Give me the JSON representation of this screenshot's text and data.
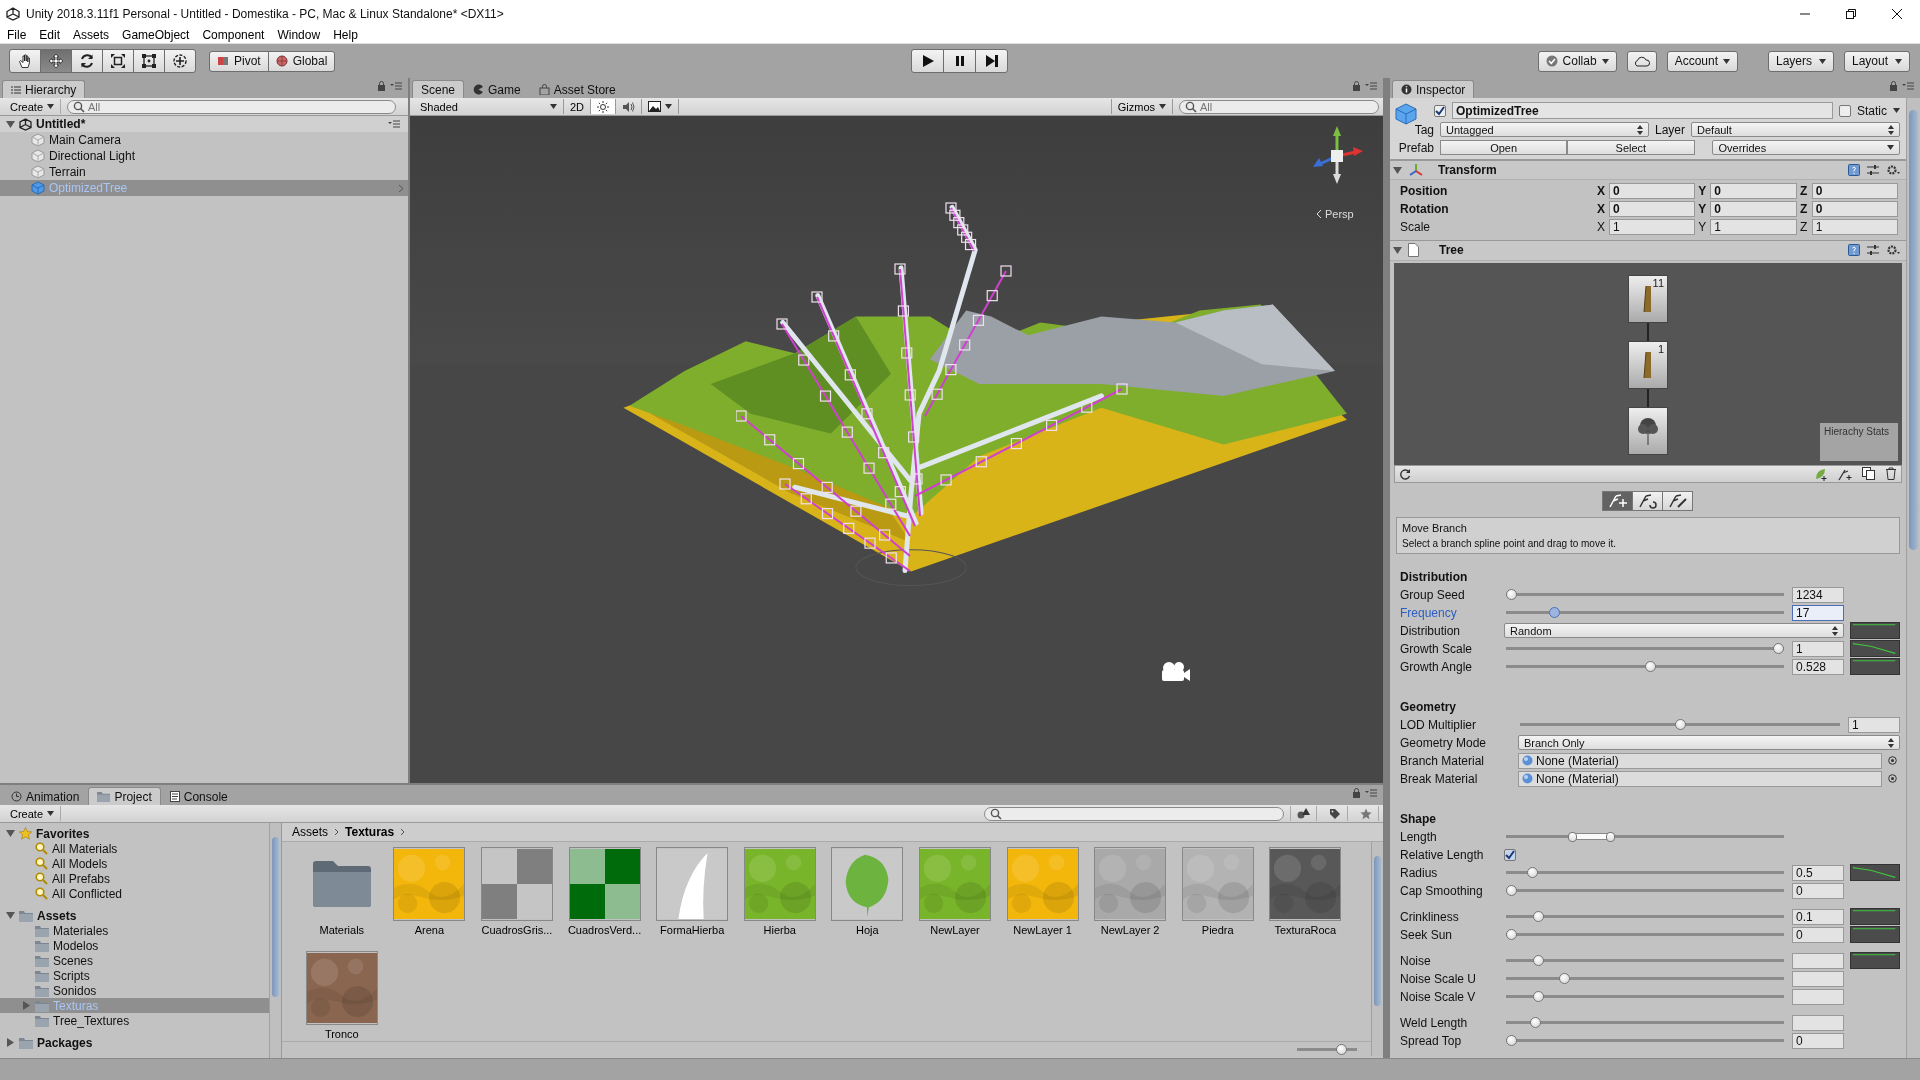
{
  "window": {
    "title": "Unity 2018.3.11f1 Personal - Untitled - Domestika - PC, Mac & Linux Standalone* <DX11>"
  },
  "menu": [
    "File",
    "Edit",
    "Assets",
    "GameObject",
    "Component",
    "Window",
    "Help"
  ],
  "toolbar": {
    "tools": [
      {
        "kind": "hand",
        "selected": false
      },
      {
        "kind": "move",
        "selected": true
      },
      {
        "kind": "rotate",
        "selected": false
      },
      {
        "kind": "scale",
        "selected": false
      },
      {
        "kind": "rect",
        "selected": false
      },
      {
        "kind": "transform",
        "selected": false
      }
    ],
    "pivot": "Pivot",
    "space": "Global",
    "play": [
      {
        "kind": "play",
        "selected": false
      },
      {
        "kind": "pause",
        "selected": false
      },
      {
        "kind": "step",
        "selected": false
      }
    ],
    "collab": "Collab",
    "account": "Account",
    "layers": "Layers",
    "layout": "Layout"
  },
  "hierarchy": {
    "tab": "Hierarchy",
    "create": "Create",
    "search_placeholder": "All",
    "scene": "Untitled*",
    "items": [
      {
        "label": "Main Camera",
        "kind": "object",
        "selected": false
      },
      {
        "label": "Directional Light",
        "kind": "object",
        "selected": false
      },
      {
        "label": "Terrain",
        "kind": "object",
        "selected": false
      },
      {
        "label": "OptimizedTree",
        "kind": "prefab",
        "selected": true
      }
    ]
  },
  "scene": {
    "tabs": [
      {
        "label": "Scene",
        "kind": "scene",
        "selected": true
      },
      {
        "label": "Game",
        "kind": "game",
        "selected": false
      },
      {
        "label": "Asset Store",
        "kind": "store",
        "selected": false
      }
    ],
    "shading": "Shaded",
    "mode_2d": "2D",
    "lighting": true,
    "audio": false,
    "gizmos": "Gizmos",
    "search_placeholder": "All",
    "projection": "Persp"
  },
  "inspector": {
    "tab": "Inspector",
    "active": true,
    "name": "OptimizedTree",
    "static": false,
    "static_label": "Static",
    "tag_label": "Tag",
    "tag": "Untagged",
    "layer_label": "Layer",
    "layer": "Default",
    "prefab_label": "Prefab",
    "prefab_buttons": [
      "Open",
      "Select"
    ],
    "overrides": "Overrides",
    "transform": {
      "title": "Transform",
      "rows": [
        {
          "label": "Position",
          "overridden": true,
          "fields": [
            {
              "axis": "X",
              "value": "0"
            },
            {
              "axis": "Y",
              "value": "0"
            },
            {
              "axis": "Z",
              "value": "0"
            }
          ]
        },
        {
          "label": "Rotation",
          "overridden": true,
          "fields": [
            {
              "axis": "X",
              "value": "0"
            },
            {
              "axis": "Y",
              "value": "0"
            },
            {
              "axis": "Z",
              "value": "0"
            }
          ]
        },
        {
          "label": "Scale",
          "overridden": false,
          "fields": [
            {
              "axis": "X",
              "value": "1"
            },
            {
              "axis": "Y",
              "value": "1"
            },
            {
              "axis": "Z",
              "value": "1"
            }
          ]
        }
      ]
    },
    "tree": {
      "title": "Tree",
      "nodes": [
        {
          "kind": "branch",
          "count": "11"
        },
        {
          "kind": "branch",
          "count": "1"
        },
        {
          "kind": "leaf"
        }
      ],
      "stats": "Hierachy Stats",
      "modes": [
        {
          "kind": "move",
          "selected": true
        },
        {
          "kind": "rotate",
          "selected": false
        },
        {
          "kind": "draw",
          "selected": false
        }
      ],
      "help_title": "Move Branch",
      "help_text": "Select a branch spline point and drag to move it.",
      "sections": [
        {
          "title": "Distribution",
          "groups": [
            [
              {
                "kind": "slider",
                "label": "Group Seed",
                "level": 0,
                "value": "1234",
                "focused": false
              },
              {
                "kind": "slider",
                "label": "Frequency",
                "level": 0.16,
                "value": "17",
                "focused": true
              },
              {
                "kind": "dropdown",
                "label": "Distribution",
                "value": "Random",
                "curve": {
                  "kind": "flat"
                }
              },
              {
                "kind": "slider",
                "label": "Growth Scale",
                "level": 1,
                "value": "1",
                "focused": false,
                "curve": {
                  "kind": "falling"
                }
              },
              {
                "kind": "slider",
                "label": "Growth Angle",
                "level": 0.52,
                "value": "0.528",
                "focused": false,
                "curve": {
                  "kind": "flat"
                }
              }
            ]
          ]
        },
        {
          "title": "Geometry",
          "groups": [
            [
              {
                "kind": "slider",
                "label": "LOD Multiplier",
                "level": 0.5,
                "value": "1",
                "focused": false
              },
              {
                "kind": "dropdown",
                "label": "Geometry Mode",
                "value": "Branch Only"
              },
              {
                "kind": "object",
                "label": "Branch Material",
                "value": "None (Material)"
              },
              {
                "kind": "object",
                "label": "Break Material",
                "value": "None (Material)"
              }
            ]
          ]
        },
        {
          "title": "Shape",
          "groups": [
            [
              {
                "kind": "range",
                "label": "Length",
                "handles": [
                  {
                    "level": 0.23
                  },
                  {
                    "level": 0.37
                  }
                ]
              },
              {
                "kind": "checkbox",
                "label": "Relative Length",
                "checked": true
              },
              {
                "kind": "slider",
                "label": "Radius",
                "level": 0.08,
                "value": "0.5",
                "focused": false,
                "curve": {
                  "kind": "falling"
                }
              },
              {
                "kind": "slider",
                "label": "Cap Smoothing",
                "level": 0,
                "value": "0",
                "focused": false
              }
            ],
            [
              {
                "kind": "slider",
                "label": "Crinkliness",
                "level": 0.1,
                "value": "0.1",
                "focused": false,
                "curve": {
                  "kind": "flat"
                }
              },
              {
                "kind": "slider",
                "label": "Seek Sun",
                "level": 0,
                "value": "0",
                "focused": false,
                "curve": {
                  "kind": "flat"
                }
              }
            ],
            [
              {
                "kind": "slider",
                "label": "Noise",
                "level": 0.1,
                "focused": false,
                "curve": {
                  "kind": "flat"
                }
              },
              {
                "kind": "slider",
                "label": "Noise Scale U",
                "level": 0.2,
                "focused": false
              },
              {
                "kind": "slider",
                "label": "Noise Scale V",
                "level": 0.1,
                "focused": false
              }
            ],
            [
              {
                "kind": "slider",
                "label": "Weld Length",
                "level": 0.09,
                "focused": false
              },
              {
                "kind": "slider",
                "label": "Spread Top",
                "level": 0,
                "value": "0",
                "focused": false
              }
            ]
          ]
        }
      ]
    }
  },
  "project": {
    "tabs": [
      {
        "label": "Animation",
        "kind": "clock",
        "selected": false
      },
      {
        "label": "Project",
        "kind": "folder",
        "selected": true
      },
      {
        "label": "Console",
        "kind": "console",
        "selected": false
      }
    ],
    "create": "Create",
    "tree": [
      {
        "label": "Favorites",
        "kind": "star",
        "expanded": true,
        "selected": false,
        "children": [
          {
            "label": "All Materials",
            "kind": "search",
            "selected": false
          },
          {
            "label": "All Models",
            "kind": "search",
            "selected": false
          },
          {
            "label": "All Prefabs",
            "kind": "search",
            "selected": false
          },
          {
            "label": "All Conflicted",
            "kind": "search",
            "selected": false
          }
        ]
      },
      {
        "label": "Assets",
        "kind": "folder",
        "expanded": true,
        "selected": false,
        "children": [
          {
            "label": "Materiales",
            "kind": "folder",
            "selected": false
          },
          {
            "label": "Modelos",
            "kind": "folder",
            "selected": false
          },
          {
            "label": "Scenes",
            "kind": "folder",
            "selected": false
          },
          {
            "label": "Scripts",
            "kind": "folder",
            "selected": false
          },
          {
            "label": "Sonidos",
            "kind": "folder",
            "selected": false
          },
          {
            "label": "Texturas",
            "kind": "folder",
            "expanded": false,
            "selected": true
          },
          {
            "label": "Tree_Textures",
            "kind": "folder",
            "selected": false
          }
        ]
      },
      {
        "label": "Packages",
        "kind": "folder",
        "expanded": false,
        "selected": false
      }
    ],
    "breadcrumb": [
      "Assets",
      "Texturas"
    ],
    "assets": [
      {
        "name": "Materials",
        "kind": "folder"
      },
      {
        "name": "Arena",
        "kind": "noise",
        "color": "#f3b70c"
      },
      {
        "name": "CuadrosGris...",
        "kind": "checker",
        "color": "#7f7f7f"
      },
      {
        "name": "CuadrosVerd...",
        "kind": "checker",
        "color": "#006b0a"
      },
      {
        "name": "FormaHierba",
        "kind": "blade",
        "color": "#ffffff"
      },
      {
        "name": "Hierba",
        "kind": "noise",
        "color": "#79b52a"
      },
      {
        "name": "Hoja",
        "kind": "leaf",
        "color": "#6db33f"
      },
      {
        "name": "NewLayer",
        "kind": "noise",
        "color": "#79b52a"
      },
      {
        "name": "NewLayer 1",
        "kind": "noise",
        "color": "#f3b70c"
      },
      {
        "name": "NewLayer 2",
        "kind": "noise",
        "color": "#a9a9a9"
      },
      {
        "name": "Piedra",
        "kind": "noise",
        "color": "#b3b3b3"
      },
      {
        "name": "TexturaRoca",
        "kind": "noise",
        "color": "#585858"
      },
      {
        "name": "Tronco",
        "kind": "noise",
        "color": "#8a6650"
      }
    ],
    "zoom_slider": {
      "level": 0.8
    }
  }
}
